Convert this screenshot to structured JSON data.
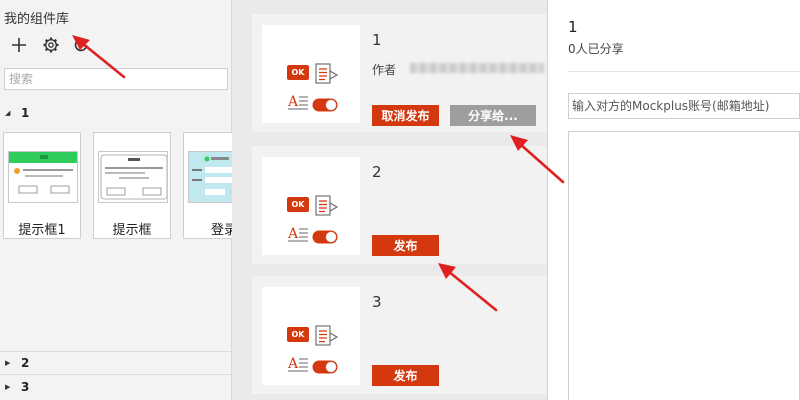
{
  "library": {
    "title": "我的组件库",
    "toolbar": {
      "add_icon": "plus-icon",
      "settings_icon": "gear-icon",
      "refresh_icon": "refresh-icon"
    },
    "search_placeholder": "搜索",
    "groups": [
      {
        "label": "1",
        "expanded": true
      },
      {
        "label": "2",
        "expanded": false
      },
      {
        "label": "3",
        "expanded": false
      }
    ],
    "components": [
      {
        "name": "提示框1"
      },
      {
        "name": "提示框"
      },
      {
        "name": "登录"
      }
    ]
  },
  "cards": [
    {
      "number": "1",
      "author_label": "作者",
      "primary_button": "取消发布",
      "secondary_button": "分享给..."
    },
    {
      "number": "2",
      "primary_button": "发布"
    },
    {
      "number": "3",
      "primary_button": "发布"
    }
  ],
  "preview": {
    "ok_text": "OK"
  },
  "share": {
    "number": "1",
    "count_text": "0人已分享",
    "input_placeholder": "输入对方的Mockplus账号(邮箱地址)"
  },
  "colors": {
    "accent": "#d3380e",
    "secondary_button": "#9e9e9e",
    "arrow": "#e02020",
    "thumb_header_green": "#2ecc5a"
  }
}
